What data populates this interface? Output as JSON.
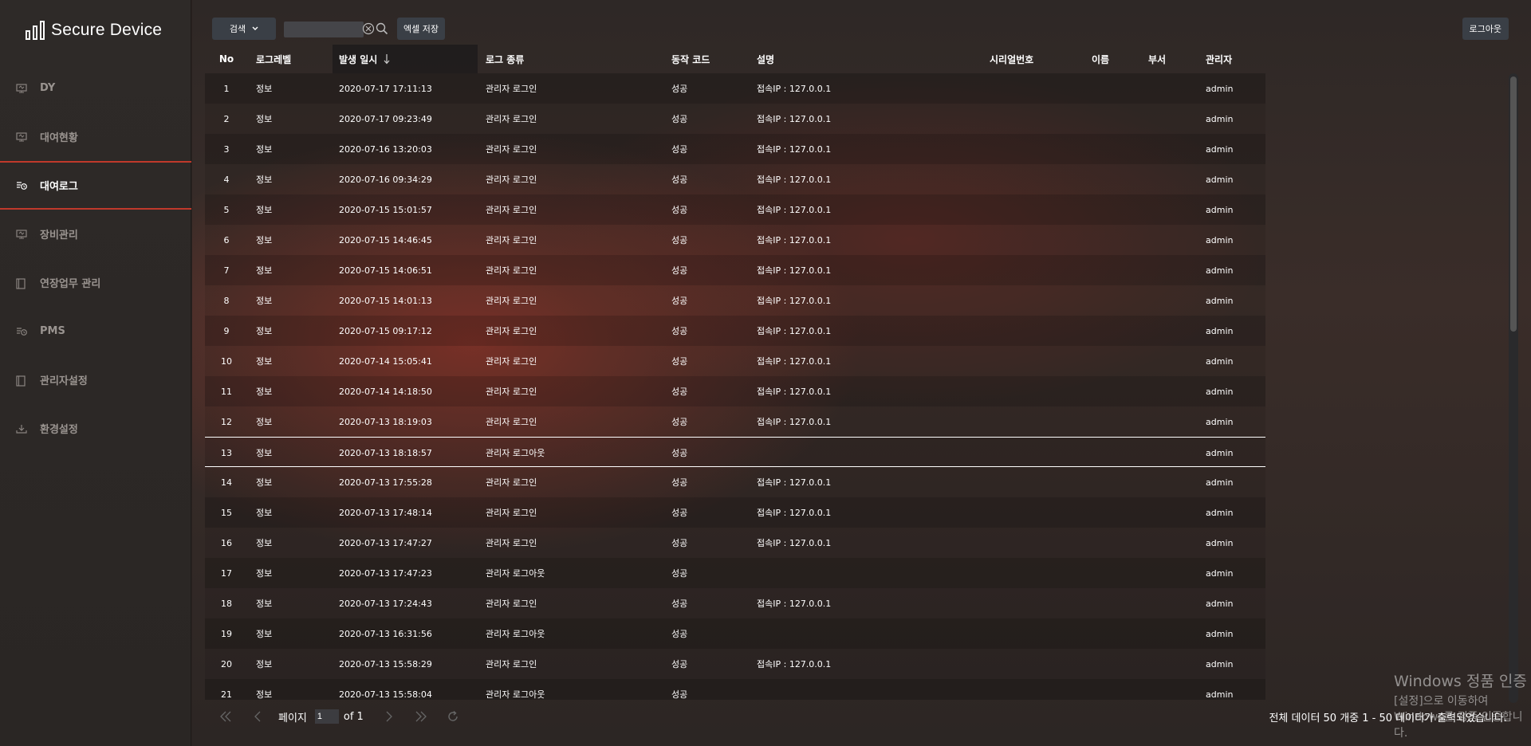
{
  "brand": {
    "name": "Secure Device"
  },
  "sidebar": {
    "items": [
      {
        "label": "DY",
        "icon": "monitor-icon",
        "active": false
      },
      {
        "label": "대여현황",
        "icon": "monitor-icon",
        "active": false
      },
      {
        "label": "대여로그",
        "icon": "log-icon",
        "active": true
      },
      {
        "label": "장비관리",
        "icon": "monitor-icon",
        "active": false
      },
      {
        "label": "연장업무 관리",
        "icon": "book-icon",
        "active": false
      },
      {
        "label": "PMS",
        "icon": "log-icon",
        "active": false
      },
      {
        "label": "관리자설정",
        "icon": "book-icon",
        "active": false
      },
      {
        "label": "환경설정",
        "icon": "download-icon",
        "active": false
      }
    ]
  },
  "toolbar": {
    "search_select": "검색",
    "search_placeholder": "",
    "excel_label": "엑셀 저장",
    "logout_label": "로그아웃"
  },
  "table": {
    "headers": {
      "no": "No",
      "level": "로그레벨",
      "time": "발생 일시",
      "type": "로그 종류",
      "code": "동작 코드",
      "desc": "설명",
      "serial": "시리얼번호",
      "name": "이름",
      "dept": "부서",
      "admin": "관리자"
    },
    "sorted_column": "time",
    "sort_direction": "desc",
    "selected_row": 13,
    "rows": [
      {
        "no": "1",
        "level": "정보",
        "time": "2020-07-17 17:11:13",
        "type": "관리자 로그인",
        "code": "성공",
        "desc": "접속IP : 127.0.0.1",
        "serial": "",
        "name": "",
        "dept": "",
        "admin": "admin"
      },
      {
        "no": "2",
        "level": "정보",
        "time": "2020-07-17 09:23:49",
        "type": "관리자 로그인",
        "code": "성공",
        "desc": "접속IP : 127.0.0.1",
        "serial": "",
        "name": "",
        "dept": "",
        "admin": "admin"
      },
      {
        "no": "3",
        "level": "정보",
        "time": "2020-07-16 13:20:03",
        "type": "관리자 로그인",
        "code": "성공",
        "desc": "접속IP : 127.0.0.1",
        "serial": "",
        "name": "",
        "dept": "",
        "admin": "admin"
      },
      {
        "no": "4",
        "level": "정보",
        "time": "2020-07-16 09:34:29",
        "type": "관리자 로그인",
        "code": "성공",
        "desc": "접속IP : 127.0.0.1",
        "serial": "",
        "name": "",
        "dept": "",
        "admin": "admin"
      },
      {
        "no": "5",
        "level": "정보",
        "time": "2020-07-15 15:01:57",
        "type": "관리자 로그인",
        "code": "성공",
        "desc": "접속IP : 127.0.0.1",
        "serial": "",
        "name": "",
        "dept": "",
        "admin": "admin"
      },
      {
        "no": "6",
        "level": "정보",
        "time": "2020-07-15 14:46:45",
        "type": "관리자 로그인",
        "code": "성공",
        "desc": "접속IP : 127.0.0.1",
        "serial": "",
        "name": "",
        "dept": "",
        "admin": "admin"
      },
      {
        "no": "7",
        "level": "정보",
        "time": "2020-07-15 14:06:51",
        "type": "관리자 로그인",
        "code": "성공",
        "desc": "접속IP : 127.0.0.1",
        "serial": "",
        "name": "",
        "dept": "",
        "admin": "admin"
      },
      {
        "no": "8",
        "level": "정보",
        "time": "2020-07-15 14:01:13",
        "type": "관리자 로그인",
        "code": "성공",
        "desc": "접속IP : 127.0.0.1",
        "serial": "",
        "name": "",
        "dept": "",
        "admin": "admin"
      },
      {
        "no": "9",
        "level": "정보",
        "time": "2020-07-15 09:17:12",
        "type": "관리자 로그인",
        "code": "성공",
        "desc": "접속IP : 127.0.0.1",
        "serial": "",
        "name": "",
        "dept": "",
        "admin": "admin"
      },
      {
        "no": "10",
        "level": "정보",
        "time": "2020-07-14 15:05:41",
        "type": "관리자 로그인",
        "code": "성공",
        "desc": "접속IP : 127.0.0.1",
        "serial": "",
        "name": "",
        "dept": "",
        "admin": "admin"
      },
      {
        "no": "11",
        "level": "정보",
        "time": "2020-07-14 14:18:50",
        "type": "관리자 로그인",
        "code": "성공",
        "desc": "접속IP : 127.0.0.1",
        "serial": "",
        "name": "",
        "dept": "",
        "admin": "admin"
      },
      {
        "no": "12",
        "level": "정보",
        "time": "2020-07-13 18:19:03",
        "type": "관리자 로그인",
        "code": "성공",
        "desc": "접속IP : 127.0.0.1",
        "serial": "",
        "name": "",
        "dept": "",
        "admin": "admin"
      },
      {
        "no": "13",
        "level": "정보",
        "time": "2020-07-13 18:18:57",
        "type": "관리자 로그아웃",
        "code": "성공",
        "desc": "",
        "serial": "",
        "name": "",
        "dept": "",
        "admin": "admin"
      },
      {
        "no": "14",
        "level": "정보",
        "time": "2020-07-13 17:55:28",
        "type": "관리자 로그인",
        "code": "성공",
        "desc": "접속IP : 127.0.0.1",
        "serial": "",
        "name": "",
        "dept": "",
        "admin": "admin"
      },
      {
        "no": "15",
        "level": "정보",
        "time": "2020-07-13 17:48:14",
        "type": "관리자 로그인",
        "code": "성공",
        "desc": "접속IP : 127.0.0.1",
        "serial": "",
        "name": "",
        "dept": "",
        "admin": "admin"
      },
      {
        "no": "16",
        "level": "정보",
        "time": "2020-07-13 17:47:27",
        "type": "관리자 로그인",
        "code": "성공",
        "desc": "접속IP : 127.0.0.1",
        "serial": "",
        "name": "",
        "dept": "",
        "admin": "admin"
      },
      {
        "no": "17",
        "level": "정보",
        "time": "2020-07-13 17:47:23",
        "type": "관리자 로그아웃",
        "code": "성공",
        "desc": "",
        "serial": "",
        "name": "",
        "dept": "",
        "admin": "admin"
      },
      {
        "no": "18",
        "level": "정보",
        "time": "2020-07-13 17:24:43",
        "type": "관리자 로그인",
        "code": "성공",
        "desc": "접속IP : 127.0.0.1",
        "serial": "",
        "name": "",
        "dept": "",
        "admin": "admin"
      },
      {
        "no": "19",
        "level": "정보",
        "time": "2020-07-13 16:31:56",
        "type": "관리자 로그아웃",
        "code": "성공",
        "desc": "",
        "serial": "",
        "name": "",
        "dept": "",
        "admin": "admin"
      },
      {
        "no": "20",
        "level": "정보",
        "time": "2020-07-13 15:58:29",
        "type": "관리자 로그인",
        "code": "성공",
        "desc": "접속IP : 127.0.0.1",
        "serial": "",
        "name": "",
        "dept": "",
        "admin": "admin"
      },
      {
        "no": "21",
        "level": "정보",
        "time": "2020-07-13 15:58:04",
        "type": "관리자 로그아웃",
        "code": "성공",
        "desc": "",
        "serial": "",
        "name": "",
        "dept": "",
        "admin": "admin"
      }
    ]
  },
  "pager": {
    "page_label": "페이지",
    "page_value": "1",
    "of_label": "of 1"
  },
  "summary": "전체 데이터 50 개중 1 - 50 데이터가 출력되었습니다.",
  "watermark": {
    "title": "Windows 정품 인증",
    "subtitle": "[설정]으로 이동하여 Windows를 정품 인증합니다."
  },
  "colors": {
    "accent": "#c0392b",
    "button_bg": "#3a3f46",
    "sidebar_bg": "#2e2a28"
  }
}
